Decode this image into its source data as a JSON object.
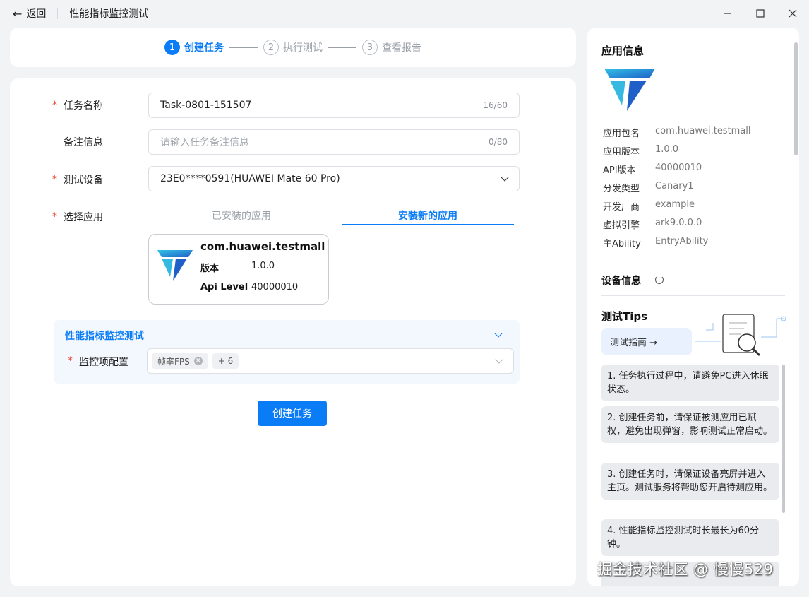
{
  "titlebar": {
    "back_label": "返回",
    "title": "性能指标监控测试"
  },
  "steps": [
    {
      "num": "1",
      "label": "创建任务"
    },
    {
      "num": "2",
      "label": "执行测试"
    },
    {
      "num": "3",
      "label": "查看报告"
    }
  ],
  "form": {
    "task_name": {
      "label": "任务名称",
      "value": "Task-0801-151507",
      "count": "16/60"
    },
    "remark": {
      "label": "备注信息",
      "placeholder": "请输入任务备注信息",
      "count": "0/80"
    },
    "device": {
      "label": "测试设备",
      "value": "23E0****0591(HUAWEI Mate 60 Pro)"
    },
    "select_app": {
      "label": "选择应用",
      "tab_installed": "已安装的应用",
      "tab_new": "安装新的应用",
      "card": {
        "package": "com.huawei.testmall",
        "version_key": "版本",
        "version_val": "1.0.0",
        "api_key": "Api Level",
        "api_val": "40000010"
      }
    },
    "section": {
      "title": "性能指标监控测试",
      "monitor_label": "监控项配置",
      "tag_fps": "帧率FPS",
      "tag_more": "+ 6"
    },
    "create_button": "创建任务"
  },
  "right": {
    "app_info_title": "应用信息",
    "app_info": [
      {
        "k": "应用包名",
        "v": "com.huawei.testmall"
      },
      {
        "k": "应用版本",
        "v": "1.0.0"
      },
      {
        "k": "API版本",
        "v": "40000010"
      },
      {
        "k": "分发类型",
        "v": "Canary1"
      },
      {
        "k": "开发厂商",
        "v": "example"
      },
      {
        "k": "虚拟引擎",
        "v": "ark9.0.0.0"
      },
      {
        "k": "主Ability",
        "v": "EntryAbility"
      }
    ],
    "device_info_title": "设备信息",
    "tips_title": "测试Tips",
    "guide_button": "测试指南 →",
    "tips": [
      "1. 任务执行过程中，请避免PC进入休眠状态。",
      "2. 创建任务前，请保证被测应用已赋权，避免出现弹窗，影响测试正常启动。",
      "3. 创建任务时，请保证设备亮屏并进入主页。测试服务将帮助您开启待测应用。",
      "4. 性能指标监控测试时长最长为60分钟。"
    ]
  },
  "watermark": "掘金技术社区 @ 慢慢529",
  "colors": {
    "accent": "#0a7cf5",
    "required": "#e84b3c"
  }
}
